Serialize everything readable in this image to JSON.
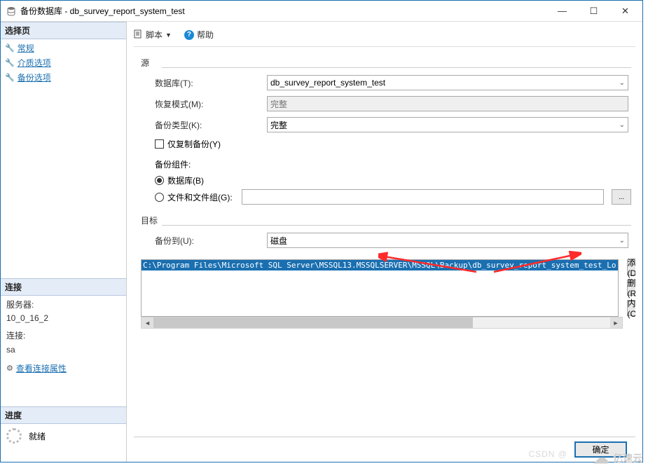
{
  "window": {
    "title": "备份数据库 - db_survey_report_system_test"
  },
  "sidebar": {
    "select_page_head": "选择页",
    "items": [
      {
        "label": "常规"
      },
      {
        "label": "介质选项"
      },
      {
        "label": "备份选项"
      }
    ],
    "connection_head": "连接",
    "server_label": "服务器:",
    "server_value": "10_0_16_2",
    "conn_label": "连接:",
    "conn_value": "sa",
    "view_conn_props": "查看连接属性",
    "progress_head": "进度",
    "progress_state": "就绪"
  },
  "toolbar": {
    "script_label": "脚本",
    "help_label": "帮助"
  },
  "source": {
    "group": "源",
    "database_label": "数据库(T):",
    "database_value": "db_survey_report_system_test",
    "recovery_label": "恢复模式(M):",
    "recovery_value": "完整",
    "backup_type_label": "备份类型(K):",
    "backup_type_value": "完整",
    "copy_only_label": "仅复制备份(Y)",
    "component_label": "备份组件:",
    "radio_database": "数据库(B)",
    "radio_filegroup": "文件和文件组(G):"
  },
  "destination": {
    "group": "目标",
    "backup_to_label": "备份到(U):",
    "backup_to_value": "磁盘",
    "list": [
      "C:\\Program Files\\Microsoft SQL Server\\MSSQL13.MSSQLSERVER\\MSSQL\\Backup\\db_survey_report_system_test_Lo"
    ],
    "add_btn": "添加(D)…",
    "remove_btn": "删除(R)",
    "contents_btn": "内容(C)"
  },
  "footer": {
    "ok": "确定"
  },
  "watermark": {
    "csdn": "CSDN @",
    "yisu": "亿速云"
  }
}
